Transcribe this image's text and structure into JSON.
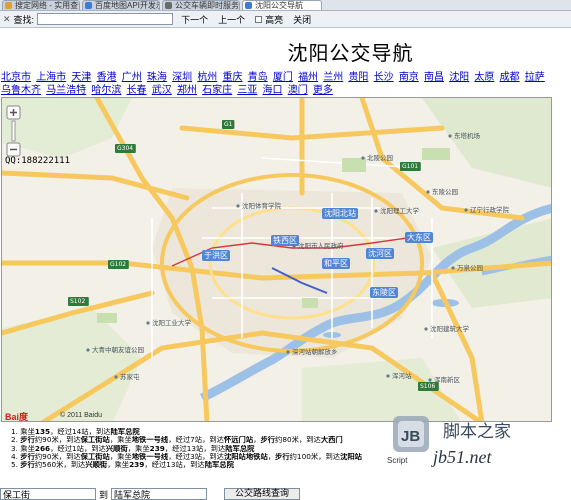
{
  "browser": {
    "tabs": [
      {
        "label": "搜定网络 - 实用查询, 站…",
        "color": "#e0a030",
        "active": false
      },
      {
        "label": "百度地图API开发示例",
        "color": "#3d7bd9",
        "active": false
      },
      {
        "label": "公交车辆即时服务接口",
        "color": "#6a6a6a",
        "active": false
      },
      {
        "label": "沈阳公交导航",
        "color": "#3d7bd9",
        "active": true
      }
    ],
    "find": {
      "close": "✕",
      "label": "查找:",
      "value": "",
      "next": "下一个",
      "prev": "上一个",
      "highlight": "高亮",
      "dismiss": "关闭"
    }
  },
  "page": {
    "title": "沈阳公交导航",
    "cities": [
      "北京市",
      "上海市",
      "天津",
      "香港",
      "广州",
      "珠海",
      "深圳",
      "杭州",
      "重庆",
      "青岛",
      "厦门",
      "福州",
      "兰州",
      "贵阳",
      "长沙",
      "南京",
      "南昌",
      "沈阳",
      "太原",
      "成都",
      "拉萨",
      "乌鲁木齐",
      "马兰浩特",
      "哈尔滨",
      "长春",
      "武汉",
      "郑州",
      "石家庄",
      "三亚",
      "海口",
      "澳门",
      "更多"
    ]
  },
  "map": {
    "qq": "QQ:188222111",
    "logo": "Bai度",
    "copyright": "© 2011 Baidu",
    "labels": [
      {
        "text": "沈阳北站",
        "kind": "highlight"
      },
      {
        "text": "铁西区",
        "kind": "highlight"
      },
      {
        "text": "于洪区",
        "kind": "highlight"
      },
      {
        "text": "和平区",
        "kind": "highlight"
      },
      {
        "text": "沈河区",
        "kind": "highlight"
      },
      {
        "text": "大东区",
        "kind": "highlight"
      },
      {
        "text": "东陵区",
        "kind": "highlight"
      },
      {
        "text": "沈阳市人民政府",
        "kind": "poi"
      },
      {
        "text": "东陵公园",
        "kind": "poi"
      },
      {
        "text": "沈阳体育学院",
        "kind": "poi"
      },
      {
        "text": "沈阳理工大学",
        "kind": "poi"
      },
      {
        "text": "辽宁行政学院",
        "kind": "poi"
      },
      {
        "text": "北陵公园",
        "kind": "poi"
      },
      {
        "text": "东塔机场",
        "kind": "poi"
      },
      {
        "text": "万泉公园",
        "kind": "poi"
      },
      {
        "text": "沈阳建筑大学",
        "kind": "poi"
      },
      {
        "text": "浑河站",
        "kind": "poi"
      },
      {
        "text": "浑南新区",
        "kind": "poi"
      },
      {
        "text": "大青中朝友谊公园",
        "kind": "poi"
      },
      {
        "text": "沈阳工业大学",
        "kind": "poi"
      },
      {
        "text": "深河站朝解放乡",
        "kind": "poi"
      },
      {
        "text": "苏家屯",
        "kind": "poi"
      },
      {
        "text": "G1",
        "kind": "shield"
      },
      {
        "text": "G304",
        "kind": "shield"
      },
      {
        "text": "G102",
        "kind": "shield"
      },
      {
        "text": "S102",
        "kind": "shield"
      },
      {
        "text": "G101",
        "kind": "shield"
      },
      {
        "text": "S106",
        "kind": "shield"
      }
    ]
  },
  "routes": [
    {
      "num": "1.",
      "parts": [
        {
          "t": "乘坐"
        },
        {
          "t": "135",
          "b": true
        },
        {
          "t": "，经过14站，到达"
        },
        {
          "t": "陆军总院",
          "b": true
        }
      ]
    },
    {
      "num": "2.",
      "parts": [
        {
          "t": "步行",
          "b": true
        },
        {
          "t": "约90米，到达"
        },
        {
          "t": "保工街站",
          "b": true
        },
        {
          "t": "，乘坐"
        },
        {
          "t": "地铁一号线",
          "b": true
        },
        {
          "t": "，经过7站，到达"
        },
        {
          "t": "怀远门站",
          "b": true
        },
        {
          "t": "，"
        },
        {
          "t": "步行",
          "b": true
        },
        {
          "t": "约80米，到达"
        },
        {
          "t": "大西门",
          "b": true
        }
      ]
    },
    {
      "num": "3.",
      "parts": [
        {
          "t": "乘坐"
        },
        {
          "t": "266",
          "b": true
        },
        {
          "t": "，经过1站，到达"
        },
        {
          "t": "兴顺街",
          "b": true
        },
        {
          "t": "，乘坐"
        },
        {
          "t": "239",
          "b": true
        },
        {
          "t": "，经过13站，到达"
        },
        {
          "t": "陆军总院",
          "b": true
        }
      ]
    },
    {
      "num": "4.",
      "parts": [
        {
          "t": "步行",
          "b": true
        },
        {
          "t": "约90米，到达"
        },
        {
          "t": "保工街站",
          "b": true
        },
        {
          "t": "，乘坐"
        },
        {
          "t": "地铁一号线",
          "b": true
        },
        {
          "t": "，经过3站，到达"
        },
        {
          "t": "沈阳站地铁站",
          "b": true
        },
        {
          "t": "，"
        },
        {
          "t": "步行",
          "b": true
        },
        {
          "t": "约100米，到达"
        },
        {
          "t": "沈阳站",
          "b": true
        }
      ]
    },
    {
      "num": "5.",
      "parts": [
        {
          "t": "步行",
          "b": true
        },
        {
          "t": "约560米，到达"
        },
        {
          "t": "兴顺街",
          "b": true
        },
        {
          "t": "，乘坐"
        },
        {
          "t": "239",
          "b": true
        },
        {
          "t": "，经过13站，到达"
        },
        {
          "t": "陆军总院",
          "b": true
        }
      ]
    }
  ],
  "watermark": {
    "logo_letter": "JB",
    "cn_text": "脚本之家",
    "script_label": "Script",
    "url": "jb51.net"
  },
  "form": {
    "from_value": "保工街",
    "to_label": "到",
    "to_value": "陆军总院",
    "button": "公交路线查询"
  }
}
